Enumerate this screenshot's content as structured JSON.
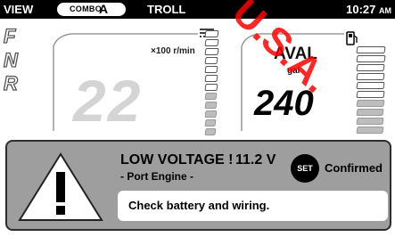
{
  "status_bar": {
    "view_label": "VIEW",
    "combo_word": "COMBO",
    "combo_letter": "A",
    "mode_label": "TROLL",
    "time": "10:27",
    "ampm": "AM"
  },
  "gears": [
    "F",
    "N",
    "R"
  ],
  "tachometer": {
    "unit": "×100 r/min",
    "value": "22",
    "bar_level_fraction": 0.45
  },
  "fuel": {
    "label": "AVAL",
    "unit": "gal",
    "value": "240",
    "bar_level_fraction": 0.4,
    "icon": "fuel-pump-icon"
  },
  "alert": {
    "title": "LOW VOLTAGE !",
    "voltage": "11.2 V",
    "source": "- Port Engine -",
    "set_label": "SET",
    "confirmed_label": "Confirmed",
    "message": "Check battery and wiring.",
    "icon": "warning-triangle-icon"
  },
  "watermark": {
    "text": "U.S.A."
  },
  "colors": {
    "bar_bg": "#000000",
    "alert_bg": "#9e9e9e",
    "watermark": "#ff0000"
  }
}
